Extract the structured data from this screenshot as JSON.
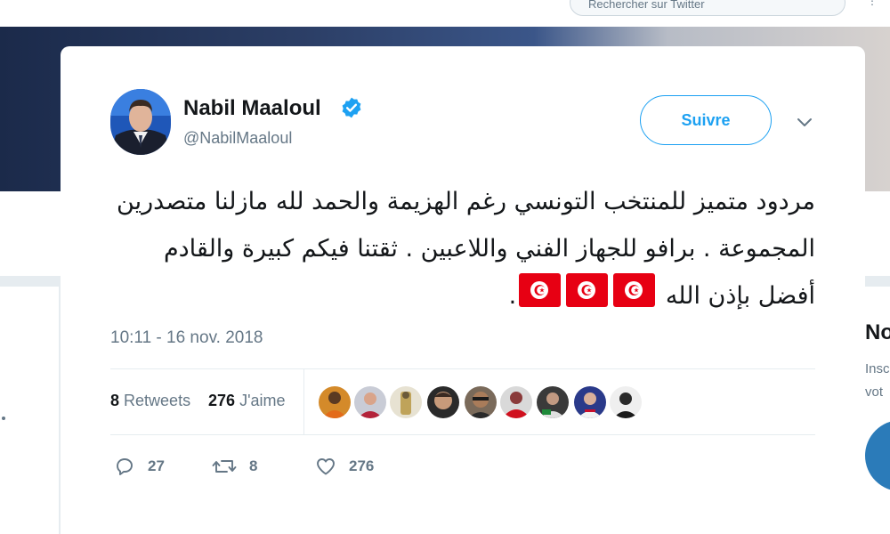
{
  "background": {
    "search_placeholder": "Rechercher sur Twitter",
    "right_card": {
      "title": "No",
      "line1": "Insc",
      "line2": "vot"
    }
  },
  "tweet": {
    "author": {
      "name": "Nabil Maaloul",
      "handle": "@NabilMaaloul",
      "verified": true
    },
    "follow_label": "Suivre",
    "text": "مردود متميز للمنتخب التونسي رغم الهزيمة والحمد لله مازلنا متصدرين المجموعة .  برافو للجهاز الفني واللاعبين . ثقتنا فيكم كبيرة والقادم أفضل بإذن الله",
    "flag_emoji_count": 3,
    "trailing_punct": ".",
    "timestamp": "10:11 - 16 nov. 2018",
    "stats": {
      "retweets_count": "8",
      "retweets_label": "Retweets",
      "likes_count": "276",
      "likes_label": "J'aime"
    },
    "actions": {
      "replies": "27",
      "retweets": "8",
      "likes": "276"
    }
  },
  "colors": {
    "accent": "#1da1f2",
    "text_primary": "#14171a",
    "text_secondary": "#657786",
    "flag_red": "#e70013"
  }
}
